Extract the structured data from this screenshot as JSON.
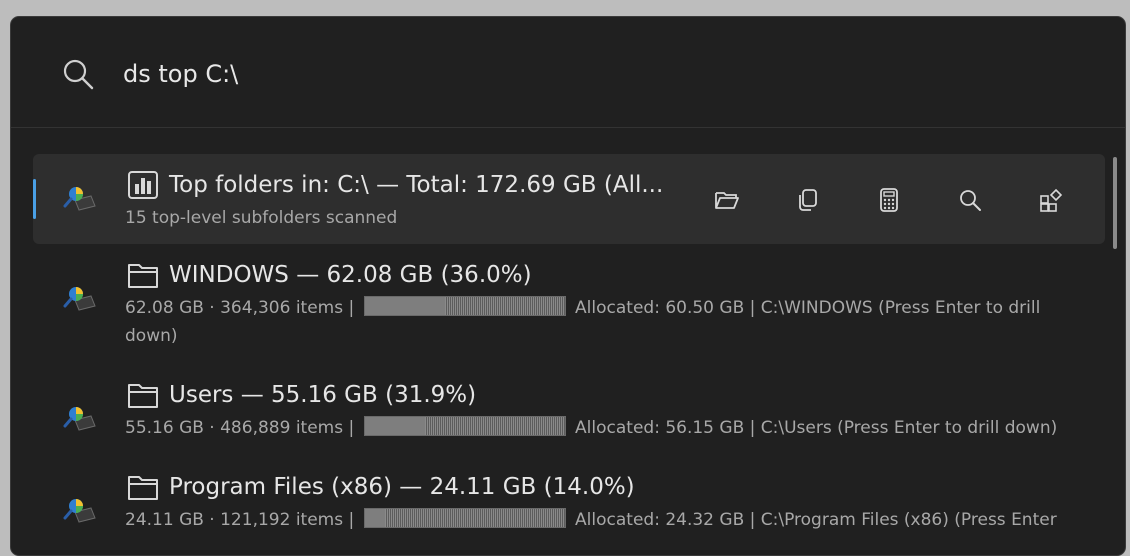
{
  "search": {
    "value": "ds top C:\\"
  },
  "header_row": {
    "title": "Top folders in: C:\\ — Total: 172.69 GB (All...",
    "subtitle": "15 top-level subfolders scanned",
    "actions": [
      {
        "name": "open-folder",
        "icon": "folder-open-icon"
      },
      {
        "name": "copy",
        "icon": "copy-icon"
      },
      {
        "name": "calculator",
        "icon": "calculator-icon"
      },
      {
        "name": "search",
        "icon": "search-icon"
      },
      {
        "name": "add-plugin",
        "icon": "apps-add-icon"
      }
    ]
  },
  "items": [
    {
      "title": "WINDOWS — 62.08 GB (36.0%)",
      "sub_prefix": "62.08 GB · 364,306 items |",
      "sub_suffix": "Allocated: 60.50 GB | C:\\WINDOWS (Press Enter to drill down)",
      "fill_fraction": 0.4
    },
    {
      "title": "Users — 55.16 GB (31.9%)",
      "sub_prefix": "55.16 GB · 486,889 items |",
      "sub_suffix": "Allocated: 56.15 GB | C:\\Users (Press Enter to drill down)",
      "fill_fraction": 0.3
    },
    {
      "title": "Program Files (x86) — 24.11 GB (14.0%)",
      "sub_prefix": "24.11 GB · 121,192 items |",
      "sub_suffix": "Allocated: 24.32 GB | C:\\Program Files (x86) (Press Enter",
      "fill_fraction": 0.1
    }
  ],
  "colors": {
    "accent": "#4aa0e6",
    "background": "#202020",
    "selected_row": "#2e2e2e"
  }
}
